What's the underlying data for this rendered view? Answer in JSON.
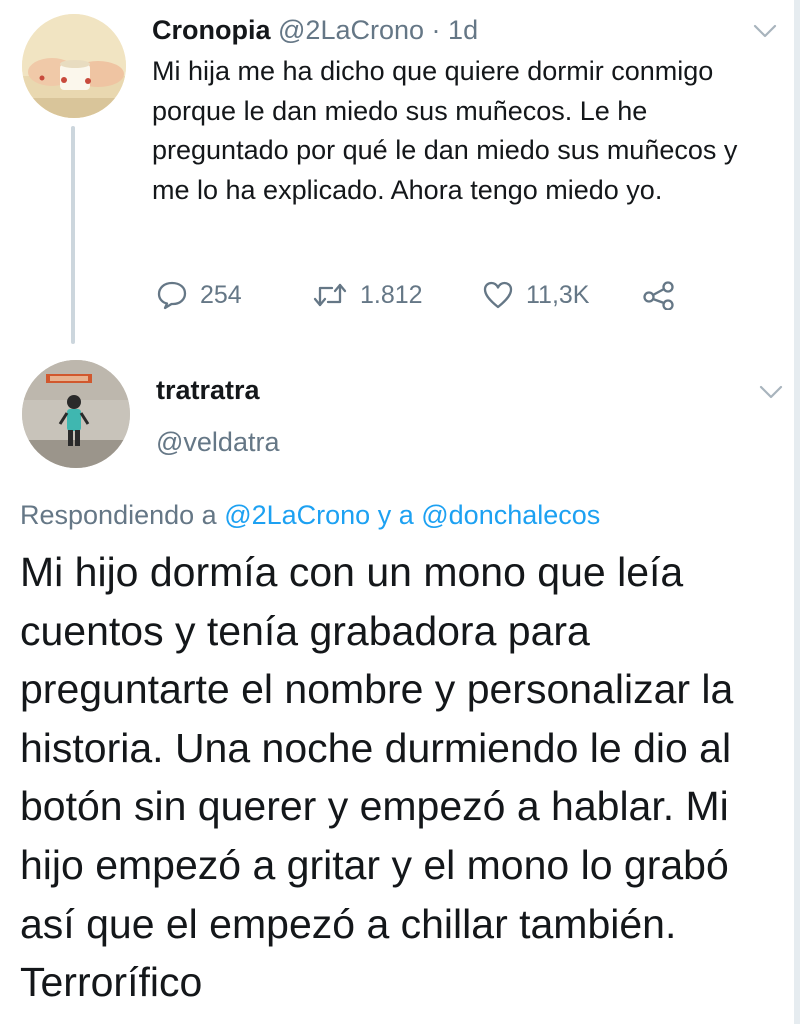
{
  "parent_tweet": {
    "display_name": "Cronopia",
    "handle": "@2LaCrono",
    "separator": "·",
    "age": "1d",
    "text": "Mi hija me ha dicho que quiere dormir conmigo porque le dan miedo sus muñecos. Le he preguntado por qué le dan miedo sus muñecos y me lo ha explicado. Ahora tengo miedo yo.",
    "actions": {
      "reply_icon": "reply-icon",
      "reply_count": "254",
      "retweet_icon": "retweet-icon",
      "retweet_count": "1.812",
      "like_icon": "heart-icon",
      "like_count": "11,3K",
      "share_icon": "share-icon"
    },
    "menu_icon": "chevron-down-icon"
  },
  "reply_tweet": {
    "display_name": "tratratra",
    "handle": "@veldatra",
    "menu_icon": "chevron-down-icon",
    "replying_prefix": "Respondiendo a",
    "replying_to_1": "@2LaCrono",
    "replying_join": "y a",
    "replying_to_2": "@donchalecos",
    "text": "Mi hijo dormía con un mono que leía cuentos y tenía grabadora para preguntarte el nombre y personalizar la historia. Una noche durmiendo le dio al botón sin querer y empezó a hablar. Mi hijo empezó a gritar y el mono lo grabó así que el empezó a chillar también. Terrorífico"
  },
  "colors": {
    "text_primary": "#14171a",
    "text_secondary": "#657786",
    "link": "#1da1f2",
    "thread_line": "#ccd6dd"
  }
}
